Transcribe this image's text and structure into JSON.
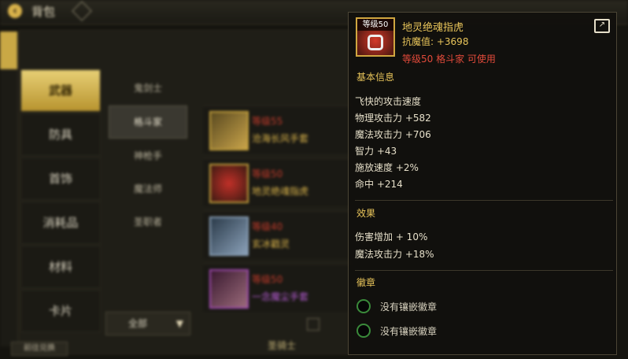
{
  "window": {
    "title": "背包"
  },
  "categories": [
    {
      "label": "武器",
      "active": true
    },
    {
      "label": "防具",
      "active": false
    },
    {
      "label": "首饰",
      "active": false
    },
    {
      "label": "消耗品",
      "active": false
    },
    {
      "label": "材料",
      "active": false
    },
    {
      "label": "卡片",
      "active": false
    }
  ],
  "subcategories": [
    {
      "label": "鬼剑士"
    },
    {
      "label": "格斗家"
    },
    {
      "label": "神枪手"
    },
    {
      "label": "魔法师"
    },
    {
      "label": "圣职者"
    }
  ],
  "items": [
    {
      "level": "等级55",
      "name": "沧海长风手套"
    },
    {
      "level": "等级50",
      "name": "地灵绝魂指虎"
    },
    {
      "level": "等级40",
      "name": "玄冰戳灵"
    },
    {
      "level": "等级50",
      "name": "一念魔尘手套"
    }
  ],
  "filter": {
    "selected": "全部"
  },
  "bottom": {
    "left_label": "前往兑换",
    "middle_label": "圣骑士"
  },
  "tooltip": {
    "icon_level": "等级50",
    "name": "地灵绝魂指虎",
    "resist": "抗魔值: +3698",
    "requirement": "等级50 格斗家 可使用",
    "basic_title": "基本信息",
    "basic_stats": [
      "飞快的攻击速度",
      "物理攻击力 +582",
      "魔法攻击力 +706",
      "智力 +43",
      "施放速度 +2%",
      "命中 +214"
    ],
    "effects_title": "效果",
    "effects": [
      "伤害增加 + 10%",
      "魔法攻击力 +18%"
    ],
    "emblem_title": "徽章",
    "emblem_slots": [
      "没有镶嵌徽章",
      "没有镶嵌徽章"
    ]
  },
  "colors": {
    "gold": "#e8c45a",
    "red": "#e24a3a",
    "text": "#e6dfc9"
  }
}
